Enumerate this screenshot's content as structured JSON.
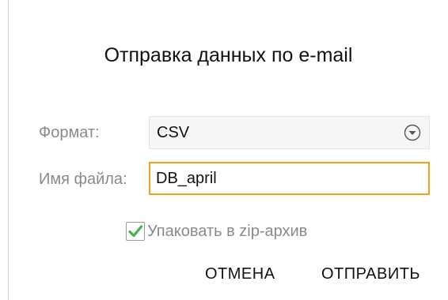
{
  "dialog": {
    "title": "Отправка данных по e-mail",
    "format": {
      "label": "Формат:",
      "selected": "CSV",
      "icon": "chevron-down-circle-icon"
    },
    "filename": {
      "label": "Имя файла:",
      "value": "DB_april"
    },
    "zip": {
      "label": "Упаковать в zip-архив",
      "checked": true,
      "check_color": "#4caf50"
    },
    "buttons": {
      "cancel_label": "ОТМЕНА",
      "send_label": "ОТПРАВИТЬ"
    }
  },
  "colors": {
    "accent_border": "#f0a11a",
    "label_gray": "#8a8a8a"
  }
}
